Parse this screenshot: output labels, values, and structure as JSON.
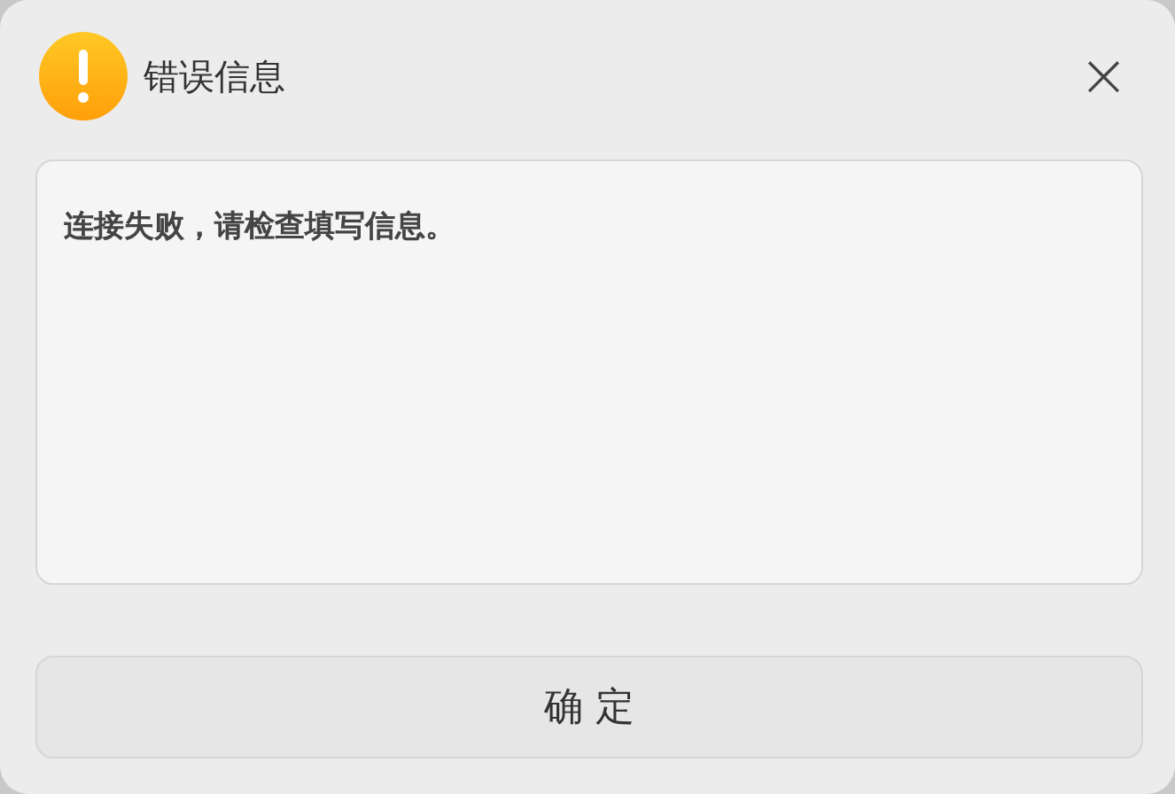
{
  "dialog": {
    "title": "错误信息",
    "close": "×",
    "message": "连接失败，请检查填写信息。",
    "buttons": [
      "确 定"
    ]
  }
}
